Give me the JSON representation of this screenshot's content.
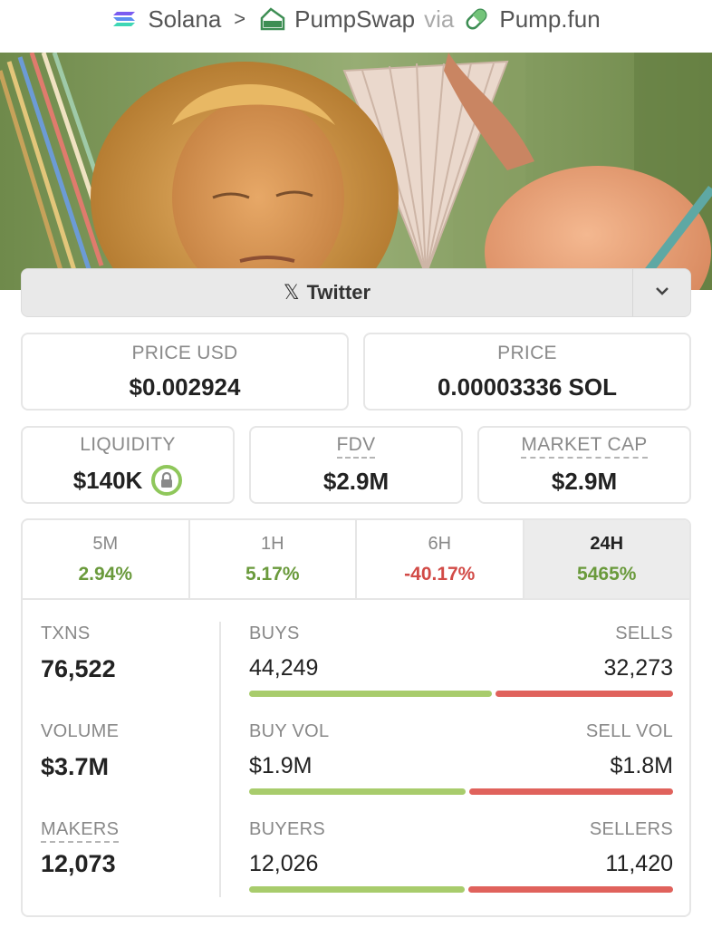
{
  "breadcrumb": {
    "chain": "Solana",
    "separator": ">",
    "dex": "PumpSwap",
    "via": "via",
    "launchpad": "Pump.fun"
  },
  "social": {
    "twitter_label": "Twitter",
    "x_glyph": "𝕏"
  },
  "price": {
    "usd_label": "PRICE USD",
    "usd_value": "$0.002924",
    "native_label": "PRICE",
    "native_value": "0.00003336 SOL"
  },
  "metrics": {
    "liquidity_label": "LIQUIDITY",
    "liquidity_value": "$140K",
    "fdv_label": "FDV",
    "fdv_value": "$2.9M",
    "mcap_label": "MARKET CAP",
    "mcap_value": "$2.9M"
  },
  "changes": [
    {
      "period": "5M",
      "value": "2.94%",
      "direction": "up"
    },
    {
      "period": "1H",
      "value": "5.17%",
      "direction": "up"
    },
    {
      "period": "6H",
      "value": "-40.17%",
      "direction": "down"
    },
    {
      "period": "24H",
      "value": "5465%",
      "direction": "up",
      "selected": true
    }
  ],
  "stats": {
    "txns_label": "TXNS",
    "txns_value": "76,522",
    "volume_label": "VOLUME",
    "volume_value": "$3.7M",
    "makers_label": "MAKERS",
    "makers_value": "12,073",
    "buys_label": "BUYS",
    "buys_value": "44,249",
    "sells_label": "SELLS",
    "sells_value": "32,273",
    "buy_vol_label": "BUY VOL",
    "buy_vol_value": "$1.9M",
    "sell_vol_label": "SELL VOL",
    "sell_vol_value": "$1.8M",
    "buyers_label": "BUYERS",
    "buyers_value": "12,026",
    "sellers_label": "SELLERS",
    "sellers_value": "11,420",
    "txn_buy_fraction": 0.578,
    "vol_buy_fraction": 0.514,
    "maker_buy_fraction": 0.513
  },
  "colors": {
    "positive": "#6a9a3c",
    "negative": "#d24b47",
    "buy_bar": "#a8cc6c",
    "sell_bar": "#e0625c",
    "lock_ring": "#8fc75b"
  },
  "icons": {
    "chain": "solana-icon",
    "dex": "pumpswap-icon",
    "launchpad": "pill-icon",
    "dropdown": "chevron-down-icon",
    "liquidity": "lock-icon"
  }
}
